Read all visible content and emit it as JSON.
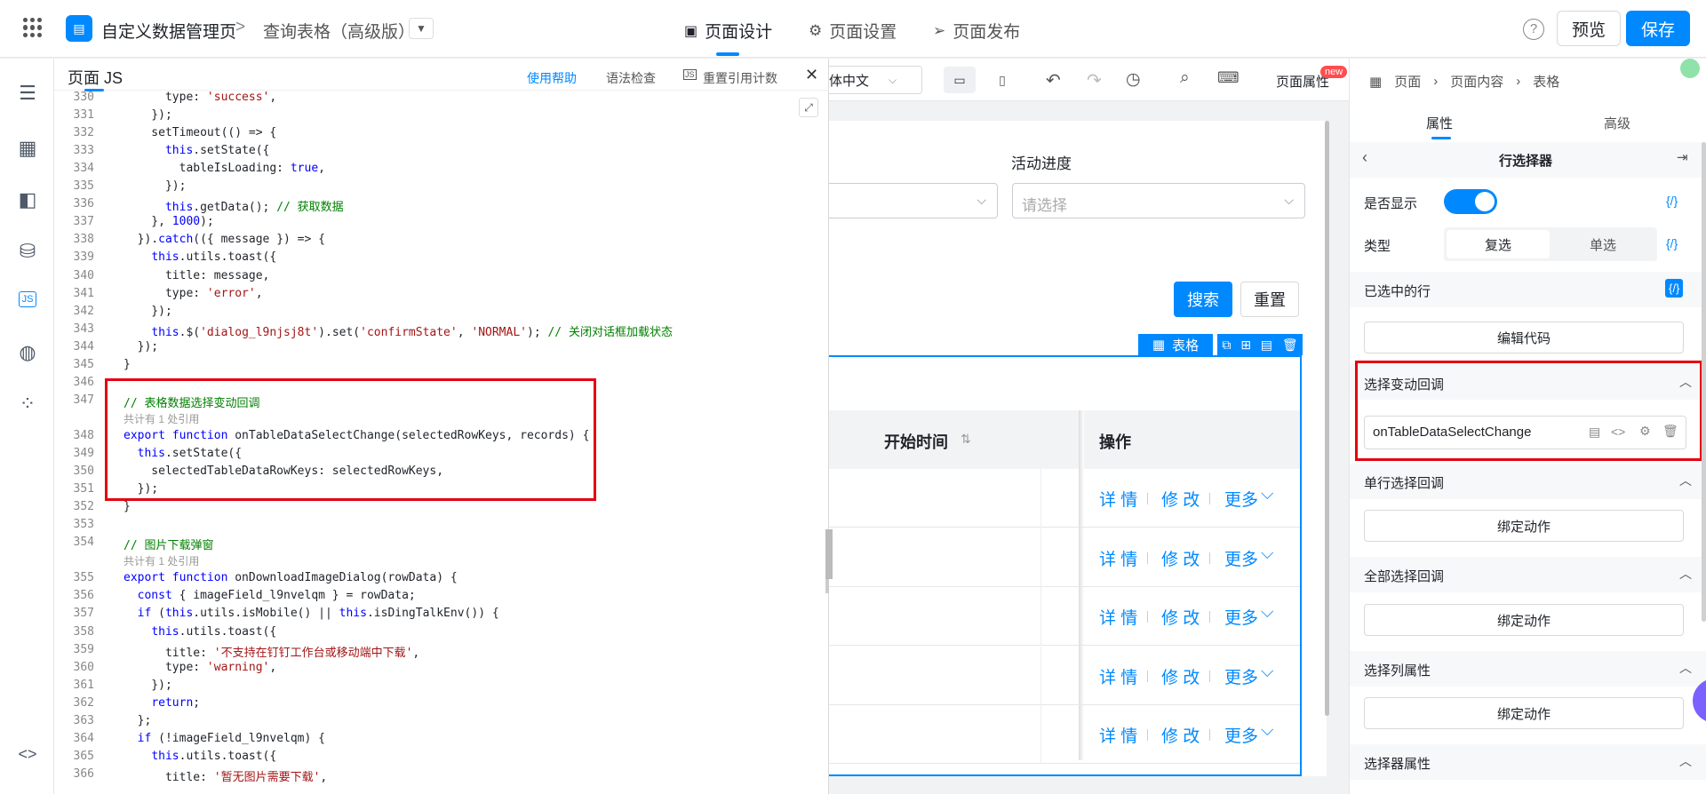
{
  "header": {
    "app_title": "自定义数据管理页",
    "breadcrumb_sep": ">",
    "page_name": "查询表格（高级版）",
    "tabs": [
      {
        "label": "页面设计"
      },
      {
        "label": "页面设置"
      },
      {
        "label": "页面发布"
      }
    ],
    "help_label": "?",
    "preview_label": "预览",
    "save_label": "保存"
  },
  "code_panel": {
    "title": "页面 JS",
    "help_link": "使用帮助",
    "lint_label": "语法检查",
    "reset_label": "重置引用计数",
    "close": "✕",
    "lines": [
      {
        "n": "330",
        "html": "      type: <span class=\"str\">'success'</span>,"
      },
      {
        "n": "331",
        "html": "    });"
      },
      {
        "n": "332",
        "html": "    setTimeout(() => {"
      },
      {
        "n": "333",
        "html": "      <span class=\"kw\">this</span>.setState({"
      },
      {
        "n": "334",
        "html": "        tableIsLoading: <span class=\"kw\">true</span>,"
      },
      {
        "n": "335",
        "html": "      });"
      },
      {
        "n": "336",
        "html": "      <span class=\"kw\">this</span>.getData(); <span class=\"cm\">// 获取数据</span>"
      },
      {
        "n": "337",
        "html": "    }, <span class=\"kw\">1000</span>);"
      },
      {
        "n": "338",
        "html": "  }).<span class=\"kw\">catch</span>(({ message }) => {"
      },
      {
        "n": "339",
        "html": "    <span class=\"kw\">this</span>.utils.toast({"
      },
      {
        "n": "340",
        "html": "      title: message,"
      },
      {
        "n": "341",
        "html": "      type: <span class=\"str\">'error'</span>,"
      },
      {
        "n": "342",
        "html": "    });"
      },
      {
        "n": "343",
        "html": "    <span class=\"kw\">this</span>.$(<span class=\"str\">'dialog_l9njsj8t'</span>).set(<span class=\"str\">'confirmState'</span>, <span class=\"str\">'NORMAL'</span>); <span class=\"cm\">// 关闭对话框加载状态</span>"
      },
      {
        "n": "344",
        "html": "  });"
      },
      {
        "n": "345",
        "html": "}"
      },
      {
        "n": "346",
        "html": ""
      },
      {
        "n": "347",
        "html": "<span class=\"cm\">// 表格数据选择变动回调</span>"
      },
      {
        "n": "",
        "html": "<span class=\"ref\">共计有 1 处引用</span>"
      },
      {
        "n": "348",
        "html": "<span class=\"kw\">export function</span> onTableDataSelectChange(selectedRowKeys, records) {"
      },
      {
        "n": "349",
        "html": "  <span class=\"kw\">this</span>.setState({"
      },
      {
        "n": "350",
        "html": "    selectedTableDataRowKeys: selectedRowKeys,"
      },
      {
        "n": "351",
        "html": "  });"
      },
      {
        "n": "352",
        "html": "}"
      },
      {
        "n": "353",
        "html": ""
      },
      {
        "n": "354",
        "html": "<span class=\"cm\">// 图片下载弹窗</span>"
      },
      {
        "n": "",
        "html": "<span class=\"ref\">共计有 1 处引用</span>"
      },
      {
        "n": "355",
        "html": "<span class=\"kw\">export function</span> onDownloadImageDialog(rowData) {"
      },
      {
        "n": "356",
        "html": "  <span class=\"kw\">const</span> { imageField_l9nvelqm } = rowData;"
      },
      {
        "n": "357",
        "html": "  <span class=\"kw\">if</span> (<span class=\"kw\">this</span>.utils.isMobile() || <span class=\"kw\">this</span>.isDingTalkEnv()) {"
      },
      {
        "n": "358",
        "html": "    <span class=\"kw\">this</span>.utils.toast({"
      },
      {
        "n": "359",
        "html": "      title: <span class=\"str\">'不支持在钉钉工作台或移动端中下载'</span>,"
      },
      {
        "n": "360",
        "html": "      type: <span class=\"str\">'warning'</span>,"
      },
      {
        "n": "361",
        "html": "    });"
      },
      {
        "n": "362",
        "html": "    <span class=\"kw\">return</span>;"
      },
      {
        "n": "363",
        "html": "  };"
      },
      {
        "n": "364",
        "html": "  <span class=\"kw\">if</span> (!imageField_l9nvelqm) {"
      },
      {
        "n": "365",
        "html": "    <span class=\"kw\">this</span>.utils.toast({"
      },
      {
        "n": "366",
        "html": "      title: <span class=\"str\">'暂无图片需要下载'</span>,"
      }
    ]
  },
  "canvas": {
    "lang_select": "体中文",
    "page_props": "页面属性",
    "new_badge": "new",
    "field_label": "活动进度",
    "placeholder": "请选择",
    "search_btn": "搜索",
    "reset_btn": "重置",
    "table_tag": "表格",
    "col_start": "开始时间",
    "col_ops": "操作",
    "row_ops": {
      "detail": "详 情",
      "modify": "修 改",
      "more": "更多"
    }
  },
  "right_panel": {
    "breadcrumb": [
      "页面",
      "页面内容",
      "表格"
    ],
    "tab_props": "属性",
    "tab_advanced": "高级",
    "section_title": "行选择器",
    "show_label": "是否显示",
    "type_label": "类型",
    "type_options": [
      "复选",
      "单选"
    ],
    "selected_rows_label": "已选中的行",
    "code_btn": "{/}",
    "edit_code": "编辑代码",
    "sections": [
      {
        "title": "选择变动回调"
      },
      {
        "title": "单行选择回调"
      },
      {
        "title": "全部选择回调"
      },
      {
        "title": "选择列属性"
      },
      {
        "title": "选择器属性"
      }
    ],
    "callback_name": "onTableDataSelectChange",
    "bind_action": "绑定动作"
  }
}
